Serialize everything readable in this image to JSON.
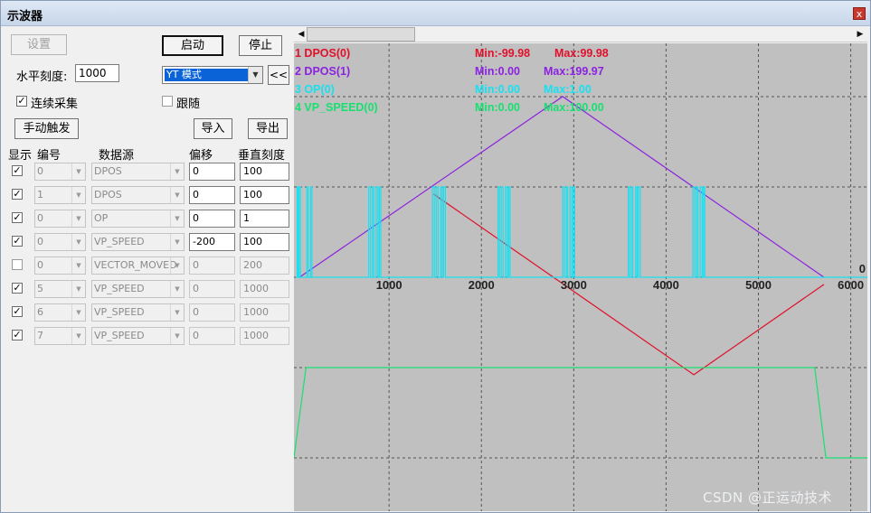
{
  "window": {
    "title": "示波器",
    "close_glyph": "x"
  },
  "panel": {
    "settings_btn": "设置",
    "start_btn": "启动",
    "stop_btn": "停止",
    "h_scale_label": "水平刻度:",
    "h_scale_value": "1000",
    "mode_value": "YT 模式",
    "collapse_btn": "<<",
    "continuous_label": "连续采集",
    "follow_label": "跟随",
    "trigger_btn": "手动触发",
    "import_btn": "导入",
    "export_btn": "导出",
    "headers": {
      "show": "显示",
      "num": "编号",
      "source": "数据源",
      "offset": "偏移",
      "vscale": "垂直刻度"
    },
    "rows": [
      {
        "checked": true,
        "num": "0",
        "source": "DPOS",
        "offset": "0",
        "vscale": "100",
        "enabled": true
      },
      {
        "checked": true,
        "num": "1",
        "source": "DPOS",
        "offset": "0",
        "vscale": "100",
        "enabled": true
      },
      {
        "checked": true,
        "num": "0",
        "source": "OP",
        "offset": "0",
        "vscale": "1",
        "enabled": true
      },
      {
        "checked": true,
        "num": "0",
        "source": "VP_SPEED",
        "offset": "-200",
        "vscale": "100",
        "enabled": true
      },
      {
        "checked": false,
        "num": "0",
        "source": "VECTOR_MOVED",
        "offset": "0",
        "vscale": "200",
        "enabled": false
      },
      {
        "checked": true,
        "num": "5",
        "source": "VP_SPEED",
        "offset": "0",
        "vscale": "1000",
        "enabled": false
      },
      {
        "checked": true,
        "num": "6",
        "source": "VP_SPEED",
        "offset": "0",
        "vscale": "1000",
        "enabled": false
      },
      {
        "checked": true,
        "num": "7",
        "source": "VP_SPEED",
        "offset": "0",
        "vscale": "1000",
        "enabled": false
      }
    ],
    "check_glyph": "✓"
  },
  "scroll": {
    "left_glyph": "◀",
    "right_glyph": "▶"
  },
  "chart_data": {
    "type": "line",
    "xlim": [
      -30,
      6180
    ],
    "x_ticks": [
      1000,
      2000,
      3000,
      4000,
      5000,
      6000
    ],
    "zero_label": "0",
    "grid": true,
    "background": "#c0c0c0",
    "legend": [
      {
        "label": "1 DPOS(0)",
        "min": "Min:-99.98",
        "max": "Max:99.98",
        "color": "#e0102a"
      },
      {
        "label": "2 DPOS(1)",
        "min": "Min:0.00",
        "max": "Max:199.97",
        "color": "#8b22e0"
      },
      {
        "label": "3 OP(0)",
        "min": "Min:0.00",
        "max": "Max:1.00",
        "color": "#18e0f0"
      },
      {
        "label": "4 VP_SPEED(0)",
        "min": "Min:0.00",
        "max": "Max:100.00",
        "color": "#18e070"
      }
    ],
    "series": [
      {
        "name": "1 DPOS(0)",
        "color": "#e0102a",
        "points": [
          [
            1480,
            100
          ],
          [
            4300,
            -100
          ],
          [
            5710,
            0
          ]
        ]
      },
      {
        "name": "2 DPOS(1)",
        "color": "#8b22e0",
        "points": [
          [
            30,
            0
          ],
          [
            2880,
            200
          ],
          [
            5710,
            0
          ]
        ]
      },
      {
        "name": "3 OP(0)",
        "color": "#18e0f0",
        "points": [
          [
            -10,
            0
          ],
          [
            5,
            0
          ],
          [
            5,
            1
          ],
          [
            15,
            1
          ],
          [
            15,
            0
          ],
          [
            25,
            0
          ],
          [
            25,
            1
          ],
          [
            40,
            1
          ],
          [
            40,
            0
          ],
          [
            110,
            0
          ],
          [
            110,
            1
          ],
          [
            125,
            1
          ],
          [
            125,
            0
          ],
          [
            150,
            0
          ],
          [
            150,
            1
          ],
          [
            165,
            1
          ],
          [
            165,
            0
          ],
          [
            780,
            0
          ],
          [
            780,
            1
          ],
          [
            800,
            1
          ],
          [
            800,
            0
          ],
          [
            820,
            0
          ],
          [
            820,
            1
          ],
          [
            835,
            1
          ],
          [
            835,
            0
          ],
          [
            860,
            0
          ],
          [
            860,
            1
          ],
          [
            880,
            1
          ],
          [
            880,
            0
          ],
          [
            895,
            0
          ],
          [
            895,
            1
          ],
          [
            910,
            1
          ],
          [
            910,
            0
          ],
          [
            1470,
            0
          ],
          [
            1470,
            1
          ],
          [
            1490,
            1
          ],
          [
            1490,
            0
          ],
          [
            1510,
            0
          ],
          [
            1510,
            1
          ],
          [
            1530,
            1
          ],
          [
            1530,
            0
          ],
          [
            1560,
            0
          ],
          [
            1560,
            1
          ],
          [
            1575,
            1
          ],
          [
            1575,
            0
          ],
          [
            1590,
            0
          ],
          [
            1590,
            1
          ],
          [
            1610,
            1
          ],
          [
            1610,
            0
          ],
          [
            2180,
            0
          ],
          [
            2180,
            1
          ],
          [
            2195,
            1
          ],
          [
            2195,
            0
          ],
          [
            2215,
            0
          ],
          [
            2215,
            1
          ],
          [
            2235,
            1
          ],
          [
            2235,
            0
          ],
          [
            2260,
            0
          ],
          [
            2260,
            1
          ],
          [
            2280,
            1
          ],
          [
            2280,
            0
          ],
          [
            2295,
            0
          ],
          [
            2295,
            1
          ],
          [
            2310,
            1
          ],
          [
            2310,
            0
          ],
          [
            2880,
            0
          ],
          [
            2880,
            1
          ],
          [
            2900,
            1
          ],
          [
            2900,
            0
          ],
          [
            2920,
            0
          ],
          [
            2920,
            1
          ],
          [
            2935,
            1
          ],
          [
            2935,
            0
          ],
          [
            2960,
            0
          ],
          [
            2960,
            1
          ],
          [
            2980,
            1
          ],
          [
            2980,
            0
          ],
          [
            2995,
            0
          ],
          [
            2995,
            1
          ],
          [
            3010,
            1
          ],
          [
            3010,
            0
          ],
          [
            3590,
            0
          ],
          [
            3590,
            1
          ],
          [
            3605,
            1
          ],
          [
            3605,
            0
          ],
          [
            3625,
            0
          ],
          [
            3625,
            1
          ],
          [
            3640,
            1
          ],
          [
            3640,
            0
          ],
          [
            3670,
            0
          ],
          [
            3670,
            1
          ],
          [
            3685,
            1
          ],
          [
            3685,
            0
          ],
          [
            3700,
            0
          ],
          [
            3700,
            1
          ],
          [
            3720,
            1
          ],
          [
            3720,
            0
          ],
          [
            4290,
            0
          ],
          [
            4290,
            1
          ],
          [
            4310,
            1
          ],
          [
            4310,
            0
          ],
          [
            4330,
            0
          ],
          [
            4330,
            1
          ],
          [
            4345,
            1
          ],
          [
            4345,
            0
          ],
          [
            4370,
            0
          ],
          [
            4370,
            1
          ],
          [
            4390,
            1
          ],
          [
            4390,
            0
          ],
          [
            4405,
            0
          ],
          [
            4405,
            1
          ],
          [
            4420,
            1
          ],
          [
            4420,
            0
          ],
          [
            6200,
            0
          ]
        ]
      },
      {
        "name": "4 VP_SPEED(0)",
        "color": "#18e070",
        "points": [
          [
            -30,
            0
          ],
          [
            100,
            100
          ],
          [
            5610,
            100
          ],
          [
            5730,
            0
          ],
          [
            6200,
            0
          ]
        ]
      }
    ],
    "y_ranges": [
      {
        "series": 0,
        "ymin": -100,
        "ymax": 100,
        "zero_frac": 0.5152,
        "unit_frac": 0.1931
      },
      {
        "series": 1,
        "ymin": 0,
        "ymax": 200,
        "zero_frac": 0.5,
        "unit_frac": 0.1931
      },
      {
        "series": 2,
        "ymin": 0,
        "ymax": 1,
        "zero_frac": 0.5,
        "unit_frac": 0.1931
      },
      {
        "series": 3,
        "ymin": 0,
        "ymax": 100,
        "zero_frac": 0.8861,
        "unit_frac": 0.1931
      }
    ]
  },
  "watermark": "CSDN @正运动技术"
}
